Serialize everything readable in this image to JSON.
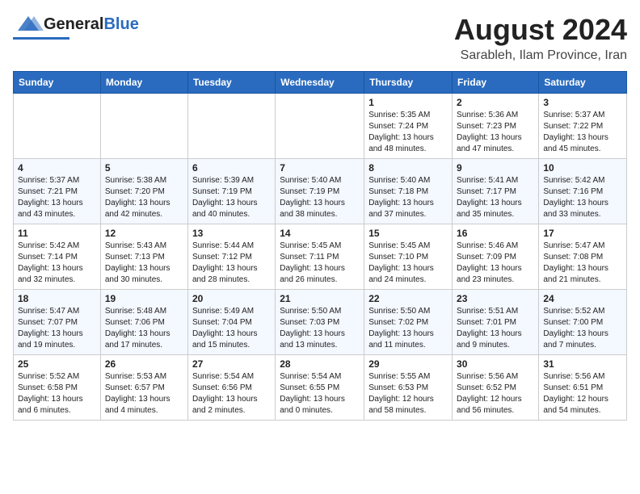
{
  "logo": {
    "general": "General",
    "blue": "Blue"
  },
  "title": "August 2024",
  "location": "Sarableh, Ilam Province, Iran",
  "days_of_week": [
    "Sunday",
    "Monday",
    "Tuesday",
    "Wednesday",
    "Thursday",
    "Friday",
    "Saturday"
  ],
  "weeks": [
    [
      {
        "day": "",
        "info": ""
      },
      {
        "day": "",
        "info": ""
      },
      {
        "day": "",
        "info": ""
      },
      {
        "day": "",
        "info": ""
      },
      {
        "day": "1",
        "info": "Sunrise: 5:35 AM\nSunset: 7:24 PM\nDaylight: 13 hours\nand 48 minutes."
      },
      {
        "day": "2",
        "info": "Sunrise: 5:36 AM\nSunset: 7:23 PM\nDaylight: 13 hours\nand 47 minutes."
      },
      {
        "day": "3",
        "info": "Sunrise: 5:37 AM\nSunset: 7:22 PM\nDaylight: 13 hours\nand 45 minutes."
      }
    ],
    [
      {
        "day": "4",
        "info": "Sunrise: 5:37 AM\nSunset: 7:21 PM\nDaylight: 13 hours\nand 43 minutes."
      },
      {
        "day": "5",
        "info": "Sunrise: 5:38 AM\nSunset: 7:20 PM\nDaylight: 13 hours\nand 42 minutes."
      },
      {
        "day": "6",
        "info": "Sunrise: 5:39 AM\nSunset: 7:19 PM\nDaylight: 13 hours\nand 40 minutes."
      },
      {
        "day": "7",
        "info": "Sunrise: 5:40 AM\nSunset: 7:19 PM\nDaylight: 13 hours\nand 38 minutes."
      },
      {
        "day": "8",
        "info": "Sunrise: 5:40 AM\nSunset: 7:18 PM\nDaylight: 13 hours\nand 37 minutes."
      },
      {
        "day": "9",
        "info": "Sunrise: 5:41 AM\nSunset: 7:17 PM\nDaylight: 13 hours\nand 35 minutes."
      },
      {
        "day": "10",
        "info": "Sunrise: 5:42 AM\nSunset: 7:16 PM\nDaylight: 13 hours\nand 33 minutes."
      }
    ],
    [
      {
        "day": "11",
        "info": "Sunrise: 5:42 AM\nSunset: 7:14 PM\nDaylight: 13 hours\nand 32 minutes."
      },
      {
        "day": "12",
        "info": "Sunrise: 5:43 AM\nSunset: 7:13 PM\nDaylight: 13 hours\nand 30 minutes."
      },
      {
        "day": "13",
        "info": "Sunrise: 5:44 AM\nSunset: 7:12 PM\nDaylight: 13 hours\nand 28 minutes."
      },
      {
        "day": "14",
        "info": "Sunrise: 5:45 AM\nSunset: 7:11 PM\nDaylight: 13 hours\nand 26 minutes."
      },
      {
        "day": "15",
        "info": "Sunrise: 5:45 AM\nSunset: 7:10 PM\nDaylight: 13 hours\nand 24 minutes."
      },
      {
        "day": "16",
        "info": "Sunrise: 5:46 AM\nSunset: 7:09 PM\nDaylight: 13 hours\nand 23 minutes."
      },
      {
        "day": "17",
        "info": "Sunrise: 5:47 AM\nSunset: 7:08 PM\nDaylight: 13 hours\nand 21 minutes."
      }
    ],
    [
      {
        "day": "18",
        "info": "Sunrise: 5:47 AM\nSunset: 7:07 PM\nDaylight: 13 hours\nand 19 minutes."
      },
      {
        "day": "19",
        "info": "Sunrise: 5:48 AM\nSunset: 7:06 PM\nDaylight: 13 hours\nand 17 minutes."
      },
      {
        "day": "20",
        "info": "Sunrise: 5:49 AM\nSunset: 7:04 PM\nDaylight: 13 hours\nand 15 minutes."
      },
      {
        "day": "21",
        "info": "Sunrise: 5:50 AM\nSunset: 7:03 PM\nDaylight: 13 hours\nand 13 minutes."
      },
      {
        "day": "22",
        "info": "Sunrise: 5:50 AM\nSunset: 7:02 PM\nDaylight: 13 hours\nand 11 minutes."
      },
      {
        "day": "23",
        "info": "Sunrise: 5:51 AM\nSunset: 7:01 PM\nDaylight: 13 hours\nand 9 minutes."
      },
      {
        "day": "24",
        "info": "Sunrise: 5:52 AM\nSunset: 7:00 PM\nDaylight: 13 hours\nand 7 minutes."
      }
    ],
    [
      {
        "day": "25",
        "info": "Sunrise: 5:52 AM\nSunset: 6:58 PM\nDaylight: 13 hours\nand 6 minutes."
      },
      {
        "day": "26",
        "info": "Sunrise: 5:53 AM\nSunset: 6:57 PM\nDaylight: 13 hours\nand 4 minutes."
      },
      {
        "day": "27",
        "info": "Sunrise: 5:54 AM\nSunset: 6:56 PM\nDaylight: 13 hours\nand 2 minutes."
      },
      {
        "day": "28",
        "info": "Sunrise: 5:54 AM\nSunset: 6:55 PM\nDaylight: 13 hours\nand 0 minutes."
      },
      {
        "day": "29",
        "info": "Sunrise: 5:55 AM\nSunset: 6:53 PM\nDaylight: 12 hours\nand 58 minutes."
      },
      {
        "day": "30",
        "info": "Sunrise: 5:56 AM\nSunset: 6:52 PM\nDaylight: 12 hours\nand 56 minutes."
      },
      {
        "day": "31",
        "info": "Sunrise: 5:56 AM\nSunset: 6:51 PM\nDaylight: 12 hours\nand 54 minutes."
      }
    ]
  ]
}
